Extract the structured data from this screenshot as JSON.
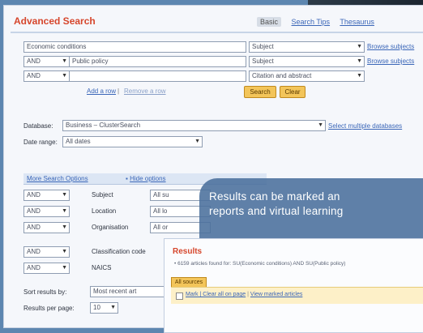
{
  "advanced_search": {
    "title": "Advanced Search",
    "tabs": [
      "Basic",
      "Search Tips",
      "Thesaurus"
    ],
    "rows": [
      {
        "op": "",
        "term": "Economic conditions",
        "field": "Subject",
        "browse": "Browse subjects"
      },
      {
        "op": "AND",
        "term": "Public policy",
        "field": "Subject",
        "browse": "Browse subjects"
      },
      {
        "op": "AND",
        "term": "",
        "field": "Citation and abstract",
        "browse": ""
      }
    ],
    "add_row": "Add a row",
    "remove_row": "Remove a row",
    "search_button": "Search",
    "clear_button": "Clear",
    "database_label": "Database:",
    "database_value": "Business – ClusterSearch",
    "database_link": "Select multiple databases",
    "date_range_label": "Date range:",
    "date_range_value": "All dates",
    "more_options": "More Search Options",
    "hide_options": "Hide options",
    "option_rows": [
      {
        "op": "AND",
        "label": "Subject",
        "value": "All su"
      },
      {
        "op": "AND",
        "label": "Location",
        "value": "All lo"
      },
      {
        "op": "AND",
        "label": "Organisation",
        "value": "All or"
      },
      {
        "op": "AND",
        "label": "Classification code",
        "value": ""
      },
      {
        "op": "AND",
        "label": "NAICS",
        "value": ""
      }
    ],
    "sort_label": "Sort results by:",
    "sort_value": "Most recent art",
    "per_page_label": "Results per page:",
    "per_page_value": "10"
  },
  "overlay": {
    "line1": "Results can be marked an",
    "line2": "reports and virtual learning"
  },
  "results": {
    "title": "Results",
    "summary": "• 6159 articles found for: SU(Economic conditions) AND SU(Public policy)",
    "tab": "All sources",
    "mark_label": "Mark | Clear all on page",
    "view_marked": "View marked articles"
  },
  "colors": {
    "accent": "#d6462c",
    "link": "#3a66b8",
    "button": "#f3c55a",
    "background": "#5d86b0"
  }
}
